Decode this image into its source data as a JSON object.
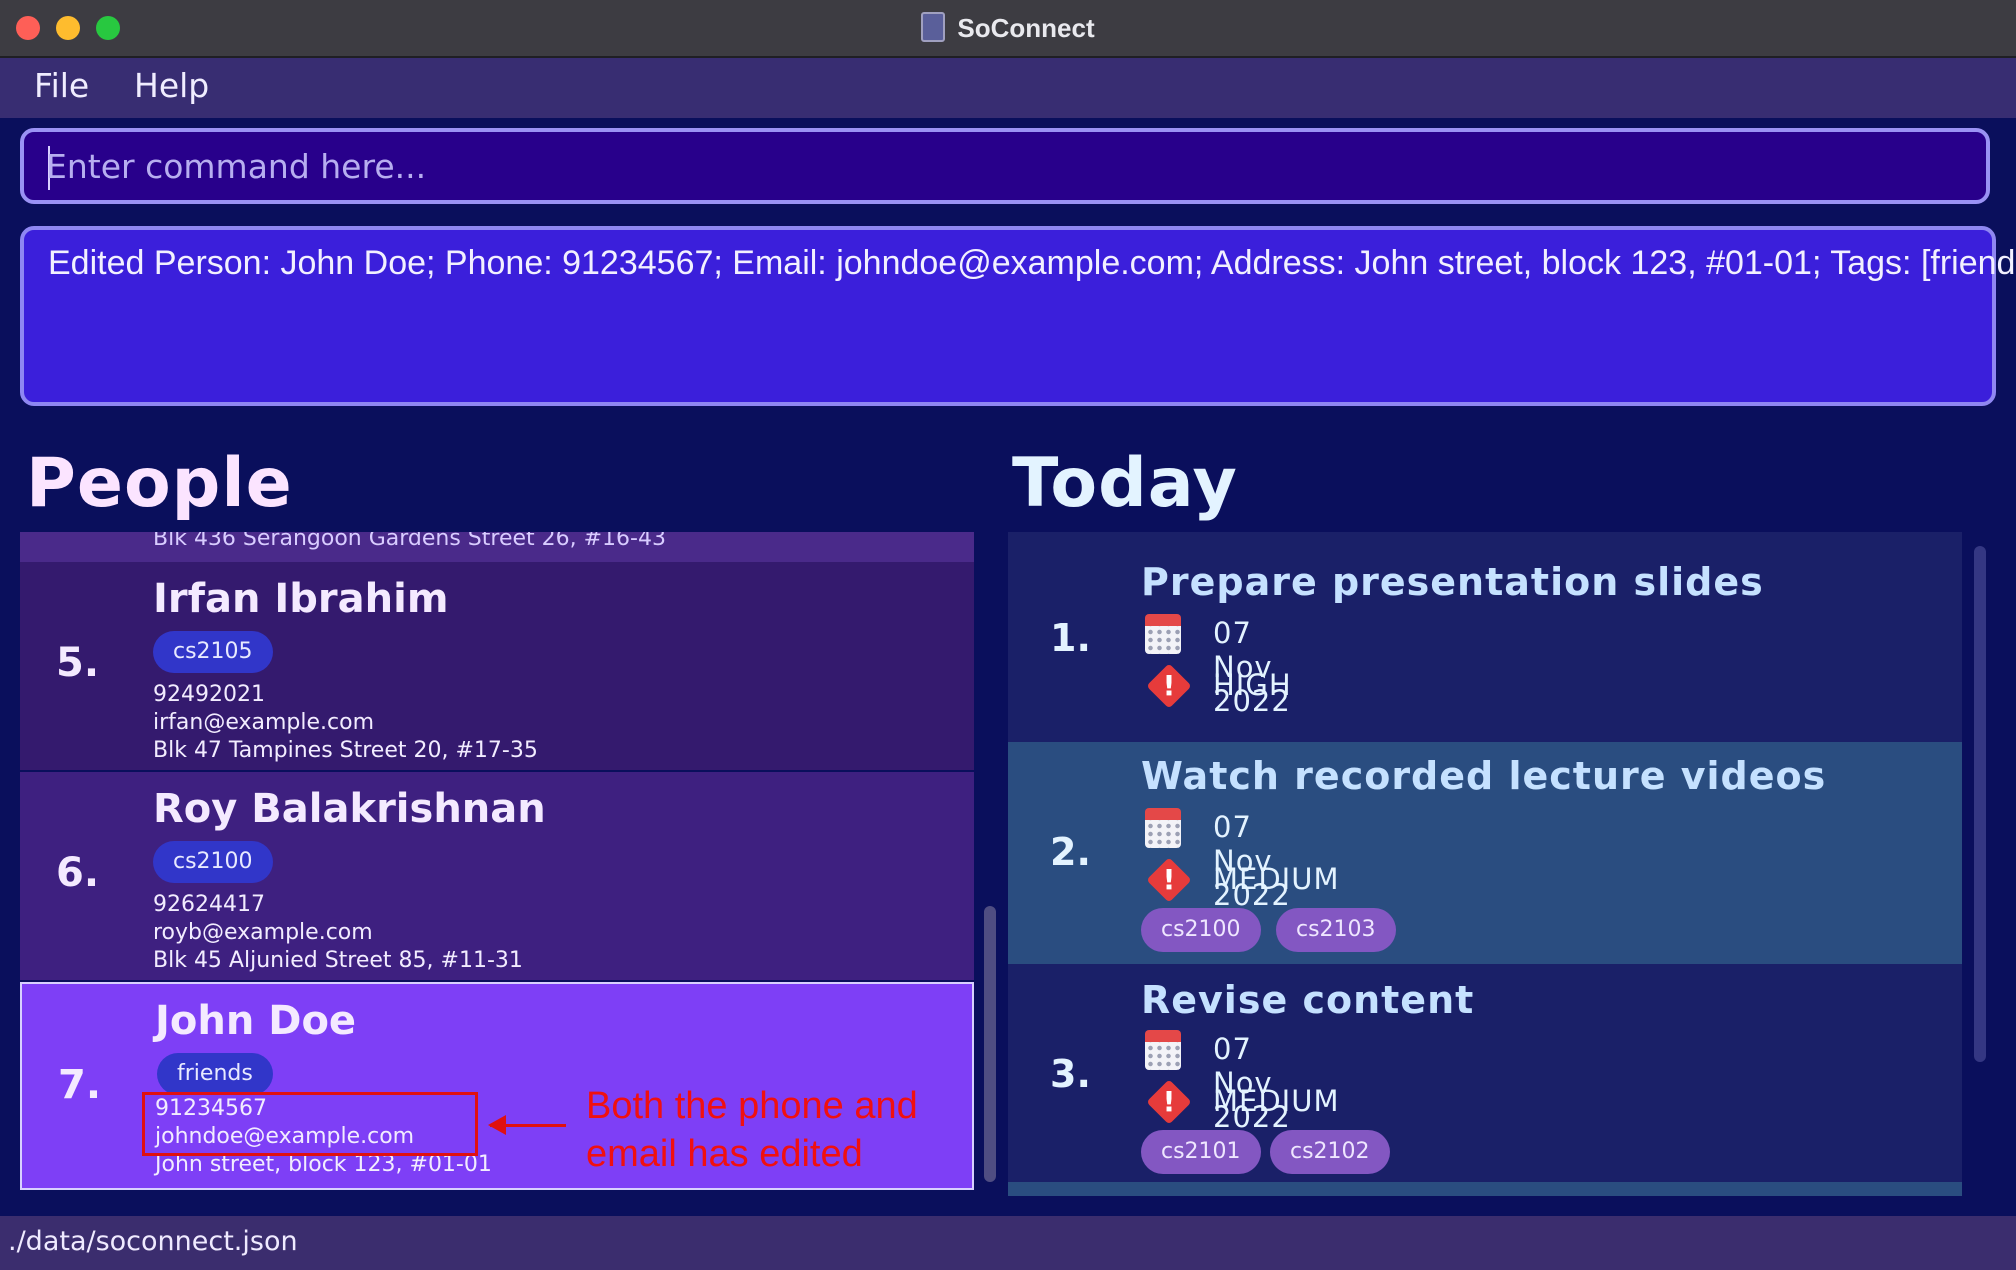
{
  "window": {
    "title": "SoConnect"
  },
  "menu": {
    "file": "File",
    "help": "Help"
  },
  "command": {
    "placeholder": "Enter command here..."
  },
  "result": {
    "text": "Edited Person: John Doe; Phone: 91234567; Email: johndoe@example.com; Address: John street, block 123, #01-01; Tags: [friends]"
  },
  "people": {
    "heading": "People",
    "previous_address": "Blk 436 Serangoon Gardens Street 26, #16-43",
    "items": [
      {
        "index": "5.",
        "name": "Irfan Ibrahim",
        "tag": "cs2105",
        "phone": "92492021",
        "email": "irfan@example.com",
        "address": "Blk 47 Tampines Street 20, #17-35"
      },
      {
        "index": "6.",
        "name": "Roy Balakrishnan",
        "tag": "cs2100",
        "phone": "92624417",
        "email": "royb@example.com",
        "address": "Blk 45 Aljunied Street 85, #11-31"
      },
      {
        "index": "7.",
        "name": "John Doe",
        "tag": "friends",
        "phone": "91234567",
        "email": "johndoe@example.com",
        "address": "John street, block 123, #01-01"
      }
    ]
  },
  "today": {
    "heading": "Today",
    "items": [
      {
        "index": "1.",
        "name": "Prepare presentation slides",
        "date": "07 Nov 2022",
        "priority": "HIGH",
        "tags": []
      },
      {
        "index": "2.",
        "name": "Watch recorded lecture videos",
        "date": "07 Nov 2022",
        "priority": "MEDIUM",
        "tags": [
          "cs2100",
          "cs2103"
        ]
      },
      {
        "index": "3.",
        "name": "Revise content",
        "date": "07 Nov 2022",
        "priority": "MEDIUM",
        "tags": [
          "cs2101",
          "cs2102"
        ]
      }
    ]
  },
  "annotation": {
    "text": "Both the phone and email has edited"
  },
  "status": {
    "path": "./data/soconnect.json"
  },
  "colors": {
    "background": "#0a0f5c",
    "selected_person": "#7e3ff6",
    "person_tag": "#3136c9",
    "task_tag": "#8357c2",
    "priority_icon": "#e63b3b",
    "annotation": "#e01010"
  },
  "icons": {
    "date": "calendar-icon",
    "priority": "priority-warning-icon"
  }
}
